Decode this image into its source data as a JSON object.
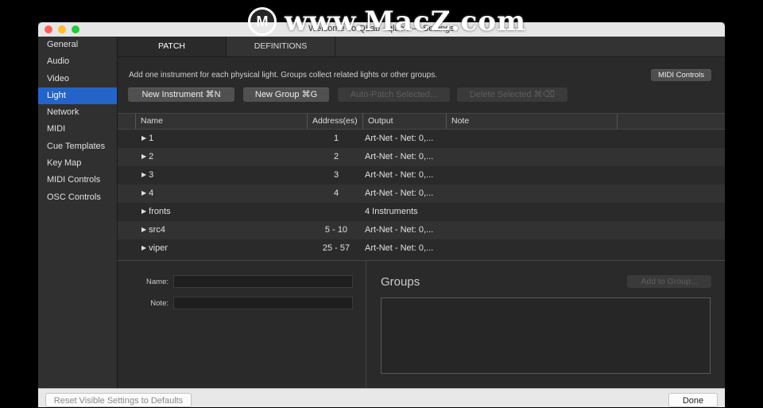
{
  "watermark": {
    "logo_letter": "M",
    "text": "www.MacZ.com"
  },
  "window": {
    "title": "Welcome To QLab - qlab4 — Settings",
    "traffic_lights": {
      "close": "#ff5f57",
      "minimize": "#febc2e",
      "zoom": "#28c840"
    }
  },
  "sidebar": {
    "items": [
      {
        "label": "General"
      },
      {
        "label": "Audio"
      },
      {
        "label": "Video"
      },
      {
        "label": "Light"
      },
      {
        "label": "Network"
      },
      {
        "label": "MIDI"
      },
      {
        "label": "Cue Templates"
      },
      {
        "label": "Key Map"
      },
      {
        "label": "MIDI Controls"
      },
      {
        "label": "OSC Controls"
      }
    ],
    "active": "Light",
    "active_color": "#2464c8"
  },
  "tabs": [
    {
      "label": "PATCH",
      "active": true
    },
    {
      "label": "DEFINITIONS",
      "active": false
    }
  ],
  "patch": {
    "hint": "Add one instrument for each physical light.  Groups collect related lights or other groups.",
    "midi_controls_label": "MIDI Controls",
    "buttons": {
      "new_instrument": "New Instrument  ⌘N",
      "new_group": "New Group  ⌘G",
      "auto_patch": "Auto-Patch Selected...",
      "delete_selected": "Delete Selected  ⌘⌫"
    },
    "columns": [
      "Name",
      "Address(es)",
      "Output",
      "Note"
    ],
    "rows": [
      {
        "name": "1",
        "address": "1",
        "output": "Art-Net - Net: 0,..."
      },
      {
        "name": "2",
        "address": "2",
        "output": "Art-Net - Net: 0,..."
      },
      {
        "name": "3",
        "address": "3",
        "output": "Art-Net - Net: 0,..."
      },
      {
        "name": "4",
        "address": "4",
        "output": "Art-Net - Net: 0,..."
      },
      {
        "name": "fronts",
        "address": "",
        "output": "4 Instruments"
      },
      {
        "name": "src4",
        "address": "5 - 10",
        "output": "Art-Net - Net: 0,..."
      },
      {
        "name": "viper",
        "address": "25 - 57",
        "output": "Art-Net - Net: 0,..."
      }
    ],
    "name_label": "Name:",
    "note_label": "Note:",
    "name_value": "",
    "note_value": "",
    "groups_title": "Groups",
    "add_to_group_label": "Add to Group..."
  },
  "footer": {
    "reset_label": "Reset Visible Settings to Defaults",
    "done_label": "Done"
  }
}
